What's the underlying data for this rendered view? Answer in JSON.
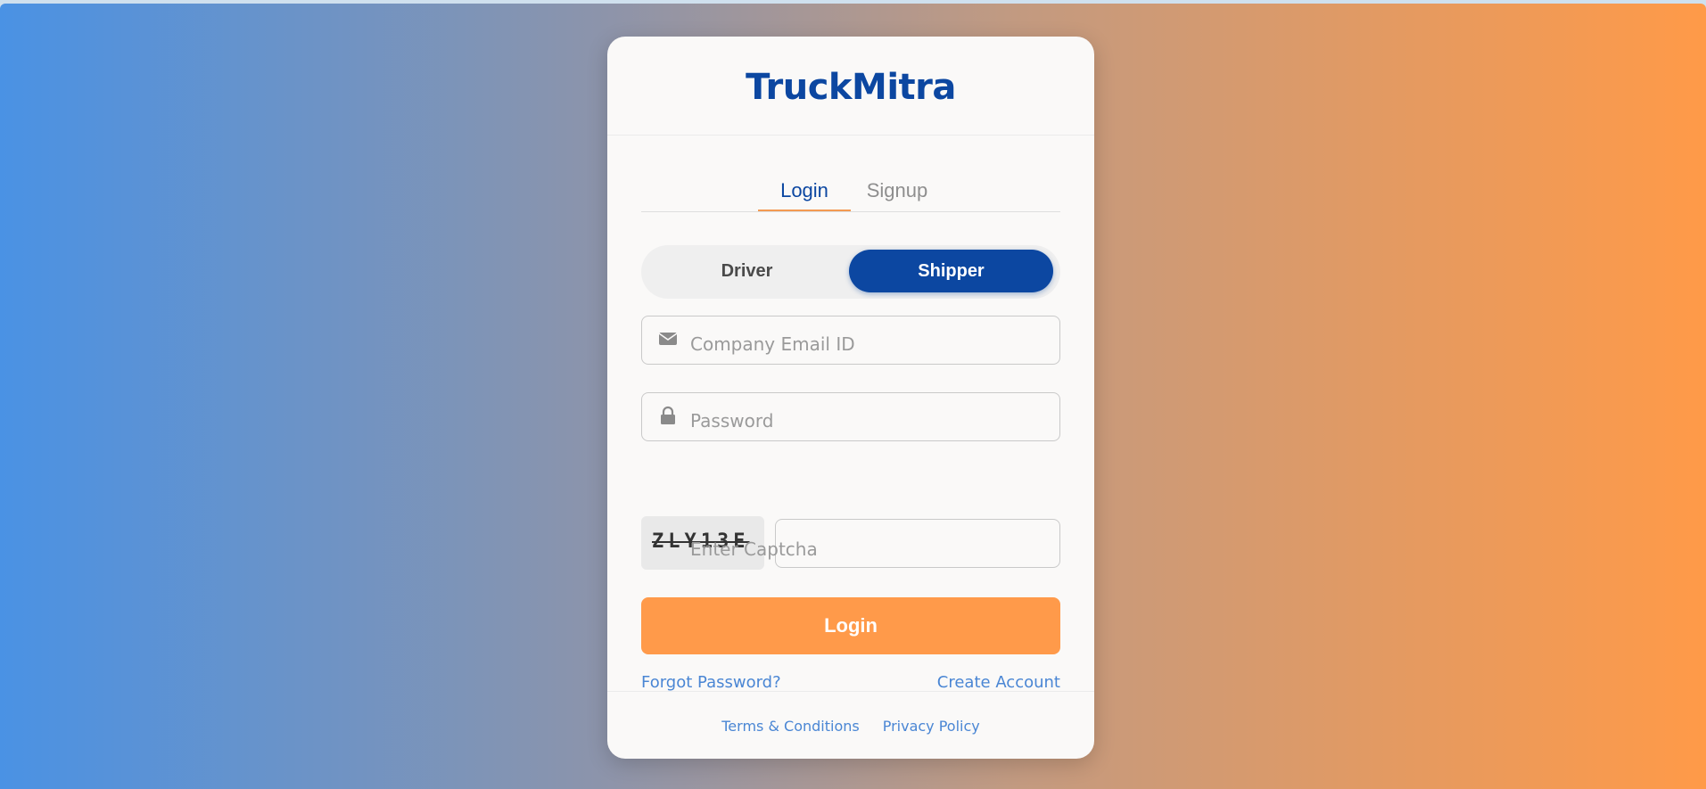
{
  "brand": {
    "title": "TruckMitra"
  },
  "tabs": [
    {
      "label": "Login",
      "active": true
    },
    {
      "label": "Signup",
      "active": false
    }
  ],
  "role_toggle": {
    "options": [
      {
        "label": "Driver",
        "selected": false
      },
      {
        "label": "Shipper",
        "selected": true
      }
    ]
  },
  "form": {
    "email": {
      "placeholder": "Company Email ID",
      "value": "",
      "icon": "envelope-icon"
    },
    "password": {
      "placeholder": "Password",
      "value": "",
      "icon": "lock-icon"
    },
    "captcha": {
      "code": "ZLY13E",
      "placeholder": "Enter Captcha",
      "value": ""
    },
    "submit_label": "Login"
  },
  "links": {
    "forgot_password": "Forgot Password?",
    "create_account": "Create Account"
  },
  "footer": {
    "terms": "Terms & Conditions",
    "privacy": "Privacy Policy"
  },
  "colors": {
    "primary": "#0c47a1",
    "accent": "#ff9a4a",
    "link": "#4a86d4",
    "bg_gradient_start": "#4a92e4",
    "bg_gradient_end": "#ff9a48"
  }
}
